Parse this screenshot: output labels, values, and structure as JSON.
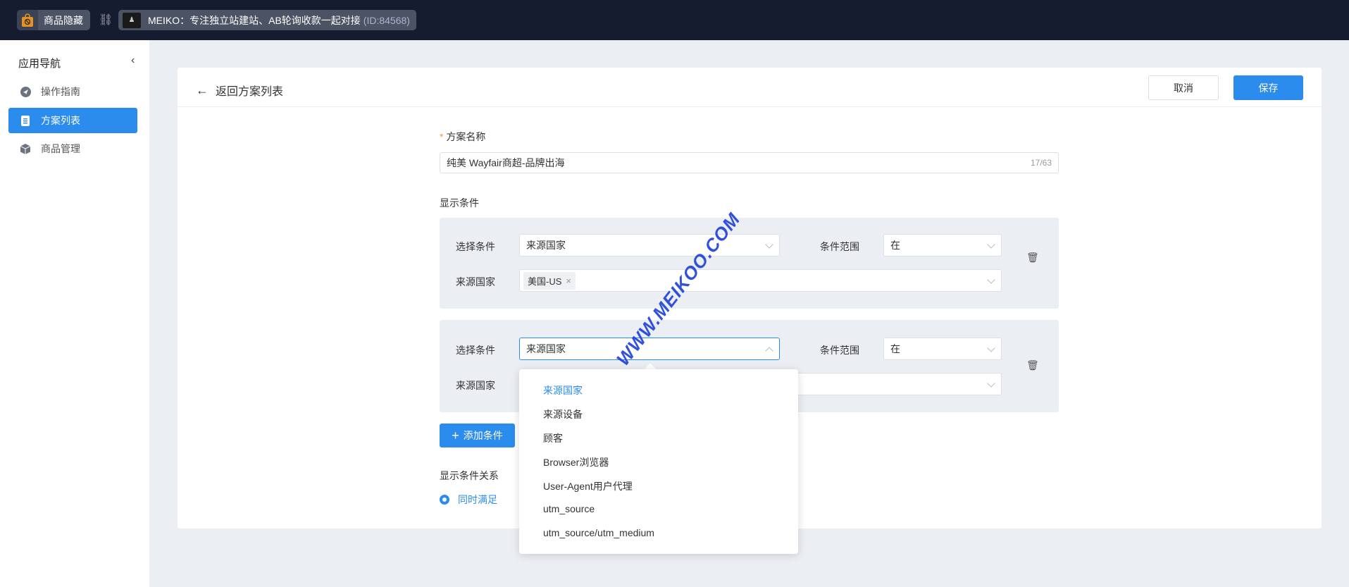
{
  "topbar": {
    "app_name": "商品隐藏",
    "store_name": "MEIKO：专注独立站建站、AB轮询收款一起对接",
    "store_id": "(ID:84568)"
  },
  "sidebar": {
    "title": "应用导航",
    "items": [
      {
        "label": "操作指南",
        "icon": "compass-icon",
        "active": false
      },
      {
        "label": "方案列表",
        "icon": "document-icon",
        "active": true
      },
      {
        "label": "商品管理",
        "icon": "box-icon",
        "active": false
      }
    ]
  },
  "header": {
    "back_label": "返回方案列表",
    "cancel_label": "取消",
    "save_label": "保存"
  },
  "form": {
    "name_label": "方案名称",
    "name_value": "纯美 Wayfair商超-品牌出海",
    "name_count": "17/63",
    "conditions_label": "显示条件",
    "conditions": [
      {
        "select_label": "选择条件",
        "select_value": "来源国家",
        "range_label": "条件范围",
        "range_value": "在",
        "country_label": "来源国家",
        "tags": [
          "美国-US"
        ]
      },
      {
        "select_label": "选择条件",
        "select_value": "来源国家",
        "range_label": "条件范围",
        "range_value": "在",
        "country_label": "来源国家",
        "tags": []
      }
    ],
    "add_label": "添加条件",
    "relation_label": "显示条件关系",
    "relation_option": "同时满足"
  },
  "dropdown": {
    "items": [
      "来源国家",
      "来源设备",
      "顾客",
      "Browser浏览器",
      "User-Agent用户代理",
      "utm_source",
      "utm_source/utm_medium"
    ],
    "selected": "来源国家"
  },
  "watermark": "WWW.MEIKOO.COM",
  "colors": {
    "primary": "#2b8ced",
    "topbar": "#151c30",
    "background": "#ebeef3"
  }
}
